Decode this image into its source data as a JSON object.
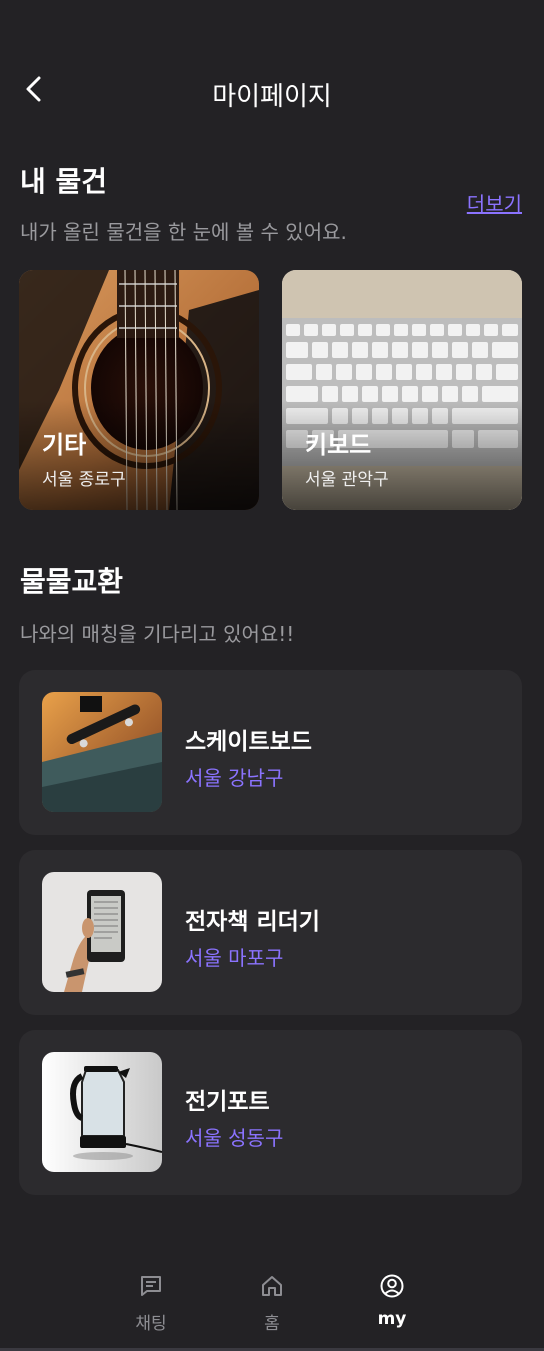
{
  "header": {
    "title": "마이페이지",
    "back_icon": "chevron-left-icon"
  },
  "my_items": {
    "title": "내 물건",
    "subtitle": "내가 올린 물건을 한 눈에 볼 수 있어요.",
    "more_label": "더보기",
    "items": [
      {
        "name": "기타",
        "location": "서울 종로구"
      },
      {
        "name": "키보드",
        "location": "서울 관악구"
      }
    ]
  },
  "exchange": {
    "title": "물물교환",
    "subtitle": "나와의 매칭을 기다리고 있어요!!",
    "items": [
      {
        "name": "스케이트보드",
        "location": "서울 강남구"
      },
      {
        "name": "전자책 리더기",
        "location": "서울 마포구"
      },
      {
        "name": "전기포트",
        "location": "서울 성동구"
      }
    ]
  },
  "bottom_nav": {
    "tabs": [
      {
        "label": "채팅",
        "icon": "chat-icon",
        "active": false
      },
      {
        "label": "홈",
        "icon": "home-icon",
        "active": false
      },
      {
        "label": "my",
        "icon": "user-circle-icon",
        "active": true
      }
    ]
  },
  "colors": {
    "background": "#232225",
    "card": "#2c2b2e",
    "accent": "#8b73ff",
    "muted": "#9a9a9e"
  }
}
